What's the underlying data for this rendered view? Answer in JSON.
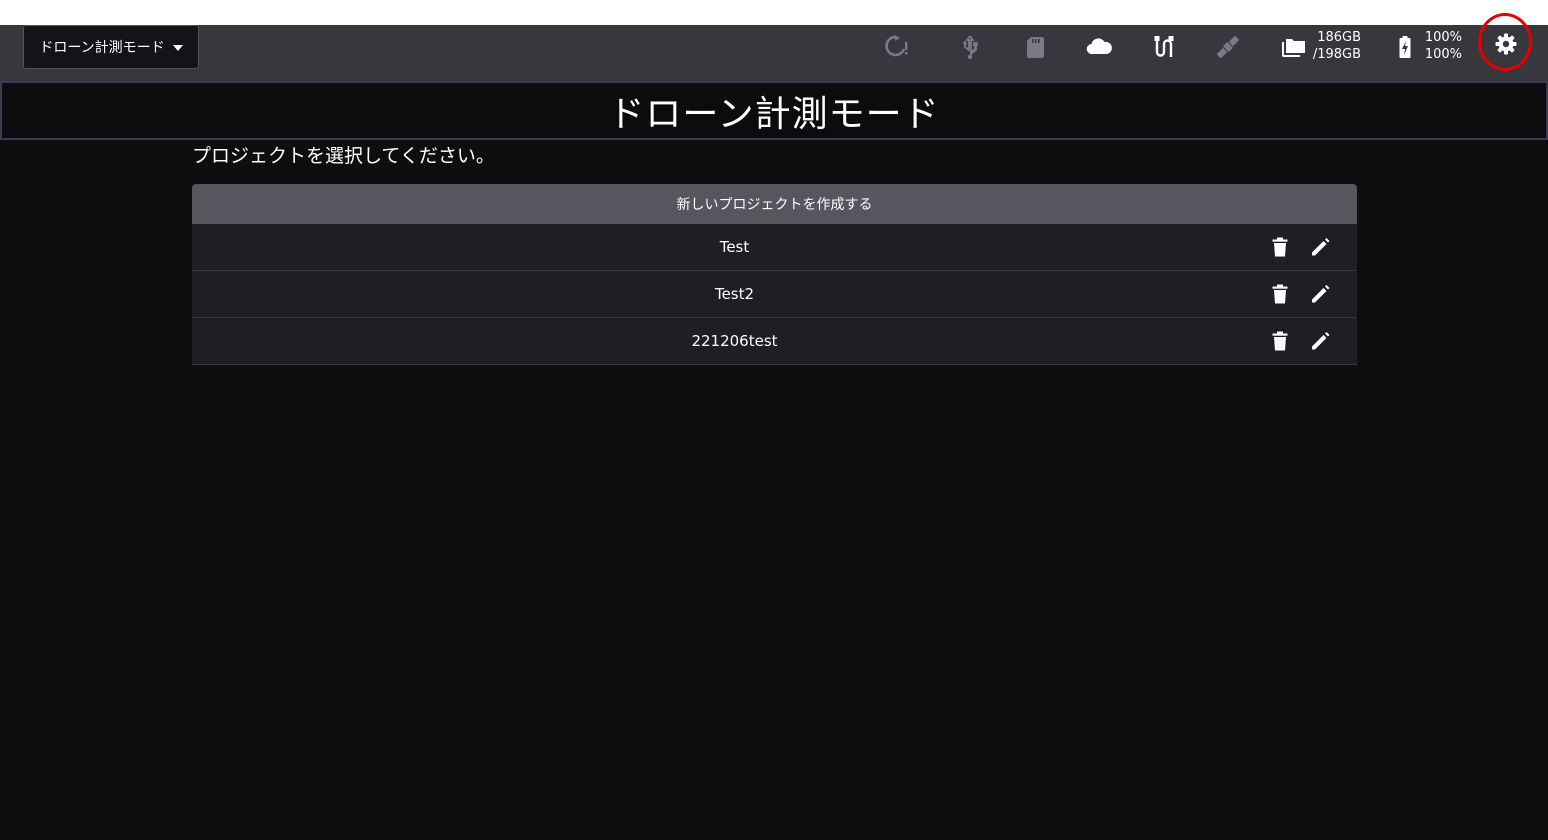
{
  "header": {
    "mode_dropdown_label": "ドローン計測モード",
    "storage": {
      "used": "186GB",
      "total": "/198GB"
    },
    "battery": {
      "level1": "100%",
      "level2": "100%"
    },
    "icons": [
      "refresh-alert-icon",
      "usb-icon",
      "sd-card-icon",
      "cloud-icon",
      "sensor-cable-icon",
      "satellite-icon",
      "folder-icon",
      "battery-charging-icon",
      "gear-icon"
    ],
    "colors": {
      "bar": "#37373d",
      "icon_active": "#ffffff",
      "icon_dim": "#7a7a82",
      "highlight_ring": "#e60000"
    }
  },
  "page": {
    "title": "ドローン計測モード",
    "subtitle": "プロジェクトを選択してください。"
  },
  "projects": {
    "new_button_label": "新しいプロジェクトを作成する",
    "items": [
      {
        "name": "Test"
      },
      {
        "name": "Test2"
      },
      {
        "name": "221206test"
      }
    ]
  }
}
